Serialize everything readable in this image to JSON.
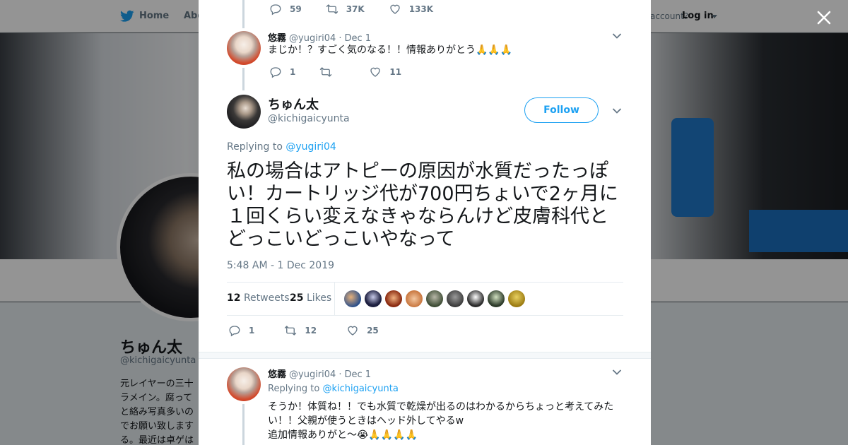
{
  "background": {
    "nav": {
      "home_label": "Home",
      "about_label": "Abo",
      "account_prompt": "account?",
      "login_label": "Log in"
    },
    "profile": {
      "name": "ちゅん太",
      "handle": "@kichigaicyunta",
      "bio": "元レイヤーの三十\nラメイン。腐って\nと絡み写真多いの\nでお願い致します\nる。最近は卓ゲは"
    }
  },
  "modal": {
    "top_tweet_actions": {
      "replies": "59",
      "retweets": "37K",
      "likes": "133K"
    },
    "reply1": {
      "name": "悠霧",
      "handle": "@yugiri04",
      "sep": "·",
      "date": "Dec 1",
      "text": "まじか！？すごく気のなる！！情報ありがとう🙏🙏🙏",
      "replies": "1",
      "retweets": "",
      "likes": "11"
    },
    "main": {
      "name": "ちゅん太",
      "handle": "@kichigaicyunta",
      "follow_label": "Follow",
      "replying_prefix": "Replying to",
      "replying_to": "@yugiri04",
      "text": "私の場合はアトピーの原因が水質だったっぽい！カートリッジ代が700円ちょいで2ヶ月に１回くらい変えなきゃならんけど皮膚科代とどっこいどっこいやなって",
      "timestamp": "5:48 AM - 1 Dec 2019",
      "retweets_count": "12",
      "retweets_label": "Retweets",
      "likes_count": "25",
      "likes_label": "Likes",
      "replies": "1",
      "retweets": "12",
      "likes": "25"
    },
    "reply2": {
      "name": "悠霧",
      "handle": "@yugiri04",
      "sep": "·",
      "date": "Dec 1",
      "replying_prefix": "Replying to",
      "replying_to": "@kichigaicyunta",
      "line1": "そうか！体質ね！！でも水質で乾燥が出るのはわかるからちょっと考えてみた",
      "line2": "い！！父親が使うときはヘッド外してやるw",
      "line3": "追加情報ありがと〜😭🙏🙏🙏🙏"
    }
  },
  "colors": {
    "accent": "#1da1f2",
    "text_primary": "#14171a",
    "text_secondary": "#657786",
    "border": "#e6ecf0"
  },
  "icons": {
    "reply": "reply-icon",
    "retweet": "retweet-icon",
    "like": "heart-icon",
    "chevron": "chevron-down-icon",
    "close": "close-icon",
    "logo": "twitter-bird-icon"
  }
}
